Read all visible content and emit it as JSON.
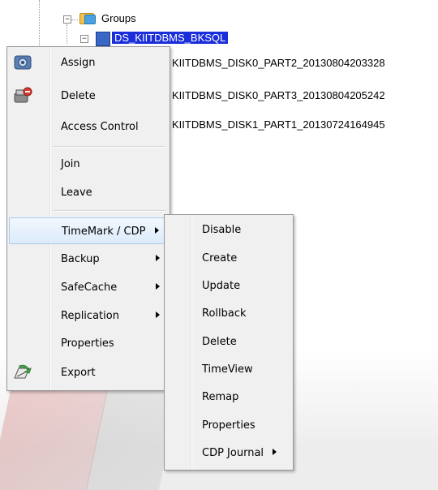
{
  "tree": {
    "groups_label": "Groups",
    "selected_label": "DS_KIITDBMS_BKSQL",
    "children": [
      "KIITDBMS_DISK0_PART2_20130804203328",
      "KIITDBMS_DISK0_PART3_20130804205242",
      "KIITDBMS_DISK1_PART1_20130724164945"
    ]
  },
  "context_menu": {
    "items": [
      {
        "label": "Assign",
        "icon": "assign-icon"
      },
      {
        "label": "Delete",
        "icon": "delete-icon"
      },
      {
        "label": "Access Control"
      },
      {
        "label": "Join"
      },
      {
        "label": "Leave"
      },
      {
        "label": "TimeMark / CDP",
        "submenu": true
      },
      {
        "label": "Backup",
        "submenu": true
      },
      {
        "label": "SafeCache",
        "submenu": true
      },
      {
        "label": "Replication",
        "submenu": true
      },
      {
        "label": "Properties"
      },
      {
        "label": "Export",
        "icon": "export-icon"
      }
    ]
  },
  "submenu": {
    "items": [
      {
        "label": "Disable"
      },
      {
        "label": "Create"
      },
      {
        "label": "Update"
      },
      {
        "label": "Rollback"
      },
      {
        "label": "Delete"
      },
      {
        "label": "TimeView"
      },
      {
        "label": "Remap"
      },
      {
        "label": "Properties"
      },
      {
        "label": "CDP Journal",
        "submenu": true
      }
    ]
  }
}
